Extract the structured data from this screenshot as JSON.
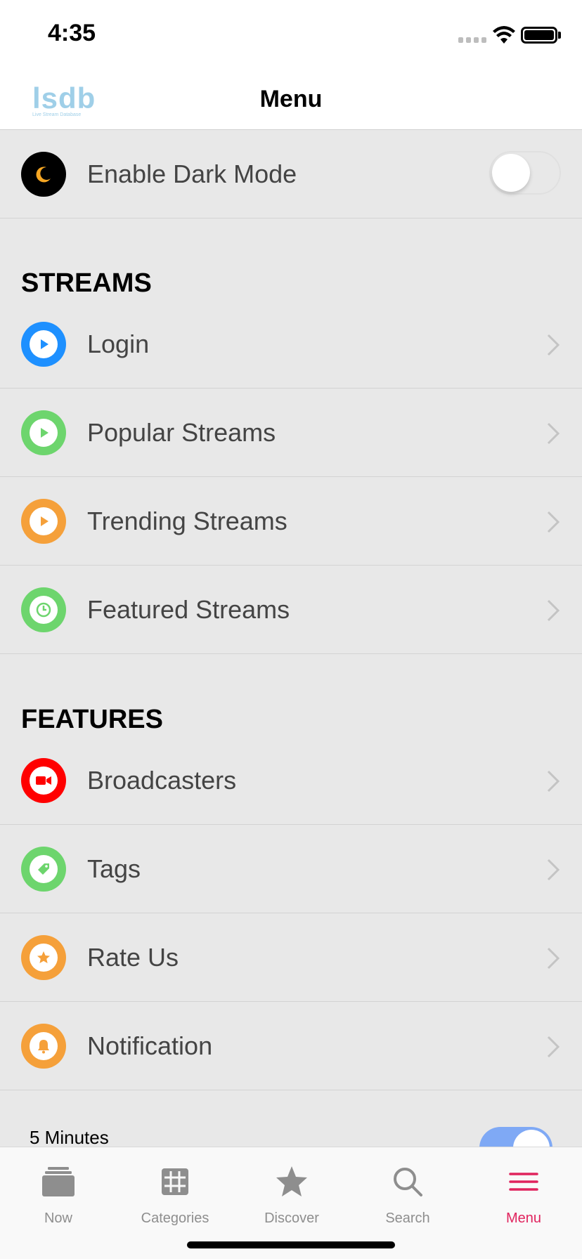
{
  "status_bar": {
    "time": "4:35"
  },
  "nav": {
    "logo_text": "lsdb",
    "logo_subtitle": "Live Stream Database",
    "title": "Menu"
  },
  "dark_mode": {
    "label": "Enable Dark Mode",
    "enabled": false
  },
  "sections": {
    "streams": {
      "header": "STREAMS",
      "items": [
        {
          "label": "Login",
          "icon": "play-icon",
          "color": "#1e90ff"
        },
        {
          "label": "Popular Streams",
          "icon": "play-icon",
          "color": "#6dd56d"
        },
        {
          "label": "Trending Streams",
          "icon": "play-icon",
          "color": "#f5a03a"
        },
        {
          "label": "Featured Streams",
          "icon": "clock-icon",
          "color": "#6dd56d"
        }
      ]
    },
    "features": {
      "header": "FEATURES",
      "items": [
        {
          "label": "Broadcasters",
          "icon": "video-camera-icon",
          "color": "#ff0000"
        },
        {
          "label": "Tags",
          "icon": "tag-icon",
          "color": "#6dd56d"
        },
        {
          "label": "Rate Us",
          "icon": "star-icon",
          "color": "#f5a03a"
        },
        {
          "label": "Notification",
          "icon": "bell-icon",
          "color": "#f5a03a"
        }
      ]
    }
  },
  "notification_interval": {
    "label": "5 Minutes",
    "enabled": true
  },
  "tab_bar": {
    "active_color": "#e0245e",
    "tabs": [
      {
        "label": "Now",
        "icon": "stack-icon"
      },
      {
        "label": "Categories",
        "icon": "grid-icon"
      },
      {
        "label": "Discover",
        "icon": "star-icon"
      },
      {
        "label": "Search",
        "icon": "search-icon"
      },
      {
        "label": "Menu",
        "icon": "menu-icon",
        "active": true
      }
    ]
  }
}
